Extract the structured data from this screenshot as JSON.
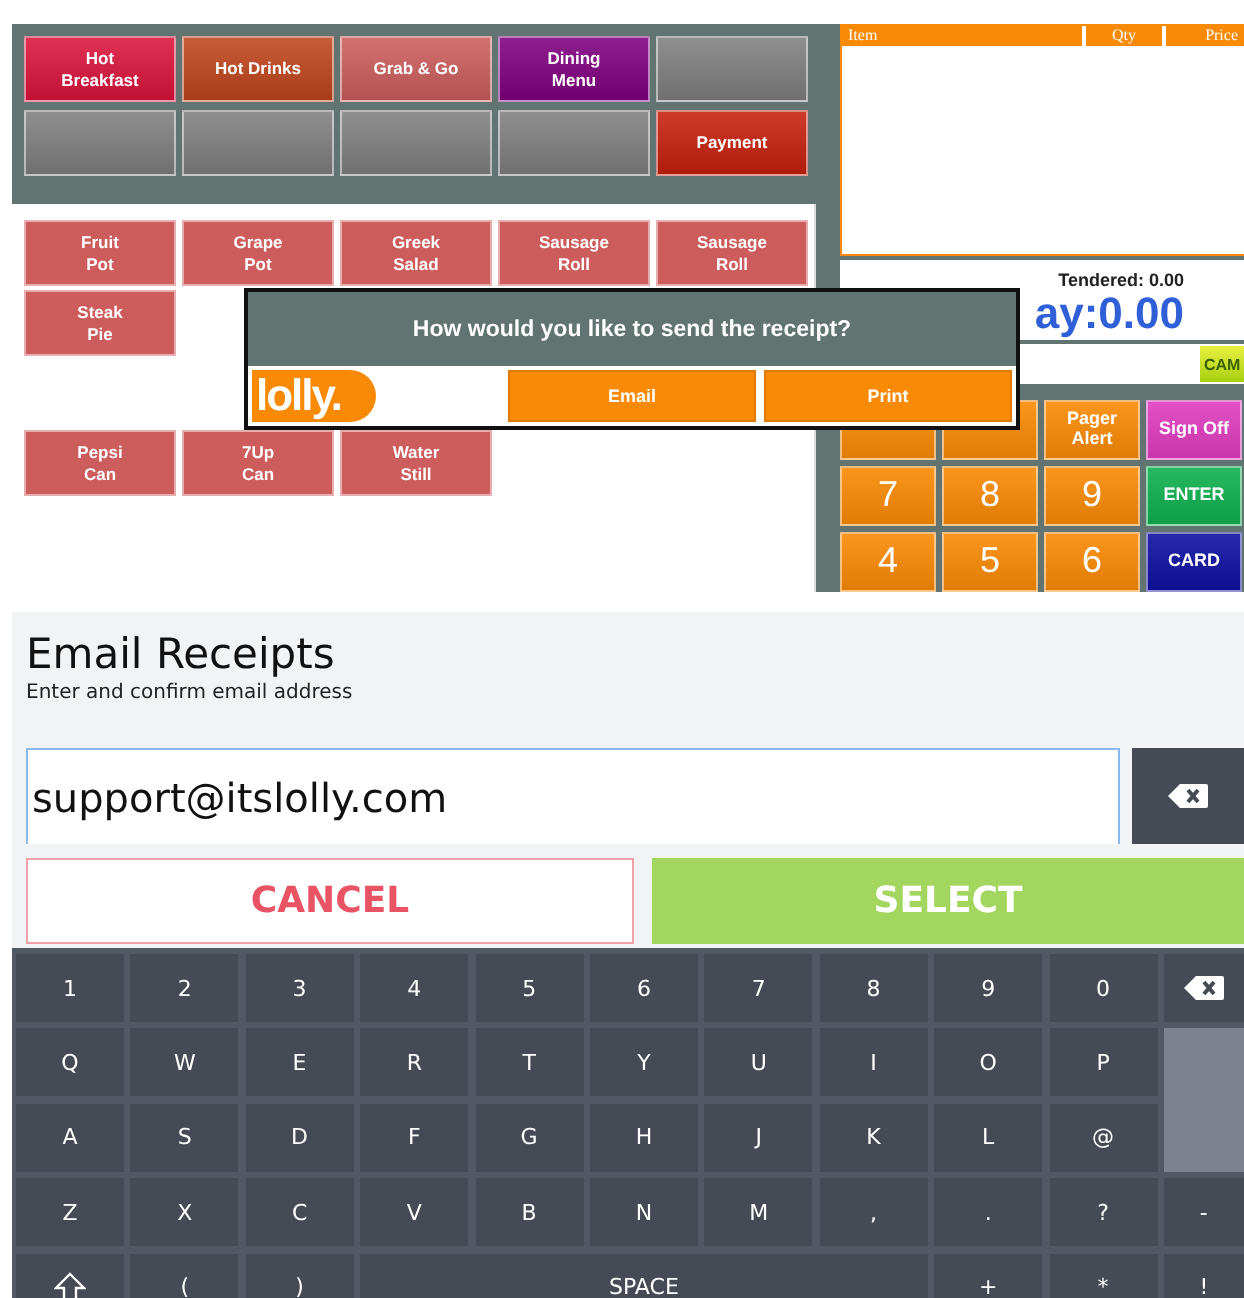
{
  "pos": {
    "categories": [
      {
        "label": "Hot\nBreakfast",
        "color": "#dc143c"
      },
      {
        "label": "Hot Drinks",
        "color": "#c0461e"
      },
      {
        "label": "Grab & Go",
        "color": "#cd5c5c"
      },
      {
        "label": "Dining\nMenu",
        "color": "#800080"
      },
      {
        "color": "#808080"
      },
      {
        "color": "#808080"
      },
      {
        "color": "#808080"
      },
      {
        "color": "#808080"
      },
      {
        "color": "#808080"
      },
      {
        "label": "Payment",
        "color": "#c8200e"
      }
    ],
    "product_rows": [
      [
        {
          "label": "Fruit\nPot"
        },
        {
          "label": "Grape\nPot"
        },
        {
          "label": "Greek\nSalad"
        },
        {
          "label": "Sausage\nRoll"
        },
        {
          "label": "Sausage\nRoll"
        }
      ],
      [
        {
          "label": "Steak\nPie"
        }
      ],
      [],
      [
        {
          "label": "Pepsi\nCan"
        },
        {
          "label": "7Up\nCan"
        },
        {
          "label": "Water\nStill"
        }
      ]
    ],
    "order_columns": [
      "Item",
      "Qty",
      "Price"
    ],
    "tendered": "Tendered: 0.00",
    "pay": "ay:0.00",
    "cam": "CAM",
    "keypad": [
      {
        "color": "#f98a05"
      },
      {
        "color": "#f98a05"
      },
      {
        "label": "Pager\nAlert",
        "color": "#f98a05"
      },
      {
        "label": "Sign Off",
        "color": "#e03cc0"
      },
      {
        "label": "7",
        "color": "#f98a05"
      },
      {
        "label": "8",
        "color": "#f98a05"
      },
      {
        "label": "9",
        "color": "#f98a05"
      },
      {
        "label": "ENTER",
        "color": "#10b050"
      },
      {
        "label": "4",
        "color": "#f98a05"
      },
      {
        "label": "5",
        "color": "#f98a05"
      },
      {
        "label": "6",
        "color": "#f98a05"
      },
      {
        "label": "CARD",
        "color": "#1010a0"
      }
    ]
  },
  "dialog": {
    "question": "How would you like to send the receipt?",
    "logo": "lolly.",
    "buttons": [
      "Email",
      "Print"
    ]
  },
  "email": {
    "title": "Email Receipts",
    "subtitle": "Enter and confirm email address",
    "value": "support@itslolly.com",
    "cancel": "CANCEL",
    "select": "SELECT",
    "keys": [
      [
        {
          "kind": "char",
          "label": "1"
        },
        {
          "kind": "char",
          "label": "2"
        },
        {
          "kind": "char",
          "label": "3"
        },
        {
          "kind": "char",
          "label": "4"
        },
        {
          "kind": "char",
          "label": "5"
        },
        {
          "kind": "char",
          "label": "6"
        },
        {
          "kind": "char",
          "label": "7"
        },
        {
          "kind": "char",
          "label": "8"
        },
        {
          "kind": "char",
          "label": "9"
        },
        {
          "kind": "char",
          "label": "0"
        },
        {
          "kind": "backspace"
        }
      ],
      [
        {
          "kind": "char",
          "label": "Q"
        },
        {
          "kind": "char",
          "label": "W"
        },
        {
          "kind": "char",
          "label": "E"
        },
        {
          "kind": "char",
          "label": "R"
        },
        {
          "kind": "char",
          "label": "T"
        },
        {
          "kind": "char",
          "label": "Y"
        },
        {
          "kind": "char",
          "label": "U"
        },
        {
          "kind": "char",
          "label": "I"
        },
        {
          "kind": "char",
          "label": "O"
        },
        {
          "kind": "char",
          "label": "P"
        },
        {
          "kind": "blank"
        }
      ],
      [
        {
          "kind": "char",
          "label": "A"
        },
        {
          "kind": "char",
          "label": "S"
        },
        {
          "kind": "char",
          "label": "D"
        },
        {
          "kind": "char",
          "label": "F"
        },
        {
          "kind": "char",
          "label": "G"
        },
        {
          "kind": "char",
          "label": "H"
        },
        {
          "kind": "char",
          "label": "J"
        },
        {
          "kind": "char",
          "label": "K"
        },
        {
          "kind": "char",
          "label": "L"
        },
        {
          "kind": "char",
          "label": "@"
        }
      ],
      [
        {
          "kind": "char",
          "label": "Z"
        },
        {
          "kind": "char",
          "label": "X"
        },
        {
          "kind": "char",
          "label": "C"
        },
        {
          "kind": "char",
          "label": "V"
        },
        {
          "kind": "char",
          "label": "B"
        },
        {
          "kind": "char",
          "label": "N"
        },
        {
          "kind": "char",
          "label": "M"
        },
        {
          "kind": "char",
          "label": ","
        },
        {
          "kind": "char",
          "label": "."
        },
        {
          "kind": "char",
          "label": "?"
        },
        {
          "kind": "char",
          "label": "-"
        }
      ],
      [
        {
          "kind": "shift"
        },
        {
          "kind": "char",
          "label": "("
        },
        {
          "kind": "char",
          "label": ")"
        },
        {
          "kind": "space",
          "label": "SPACE"
        },
        {
          "kind": "char",
          "label": "+"
        },
        {
          "kind": "char",
          "label": "*"
        },
        {
          "kind": "char",
          "label": "!"
        }
      ]
    ]
  }
}
